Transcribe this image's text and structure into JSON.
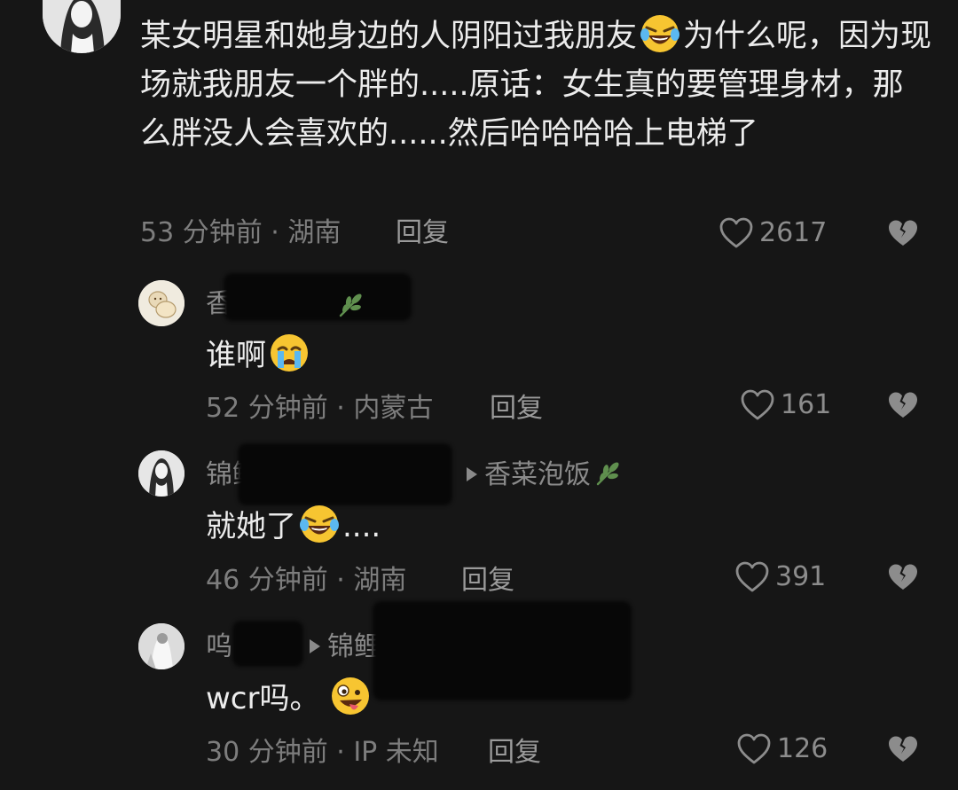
{
  "main_comment": {
    "text_part1": "某女明星和她身边的人阴阳过我朋友",
    "emoji": "laughing-crying-emoji",
    "text_part2": "为什么呢，因为现场就我朋友一个胖的.....原话：女生真的要管理身材，那么胖没人会喜欢的......然后哈哈哈哈上电梯了",
    "time": "53 分钟前 · 湖南",
    "reply_label": "回复",
    "likes": "2617"
  },
  "replies": [
    {
      "name": "香",
      "text": "谁啊",
      "emoji": "crying-emoji",
      "time": "52 分钟前 · 内蒙古",
      "reply_label": "回复",
      "likes": "161"
    },
    {
      "name": "锦鲤",
      "reply_to": "香菜泡饭",
      "text_part1": "就她了",
      "emoji": "laughing-crying-emoji",
      "text_part2": "....",
      "time": "46 分钟前 · 湖南",
      "reply_label": "回复",
      "likes": "391"
    },
    {
      "name": "呜",
      "reply_to": "锦鲤",
      "text": "wcr吗。",
      "emoji": "zany-emoji",
      "time": "30 分钟前 · IP 未知",
      "reply_label": "回复",
      "likes": "126"
    }
  ],
  "colors": {
    "background": "#161616",
    "text": "#ececec",
    "meta": "#7d7d7d",
    "leaf_badge": "#5f8f4e"
  }
}
